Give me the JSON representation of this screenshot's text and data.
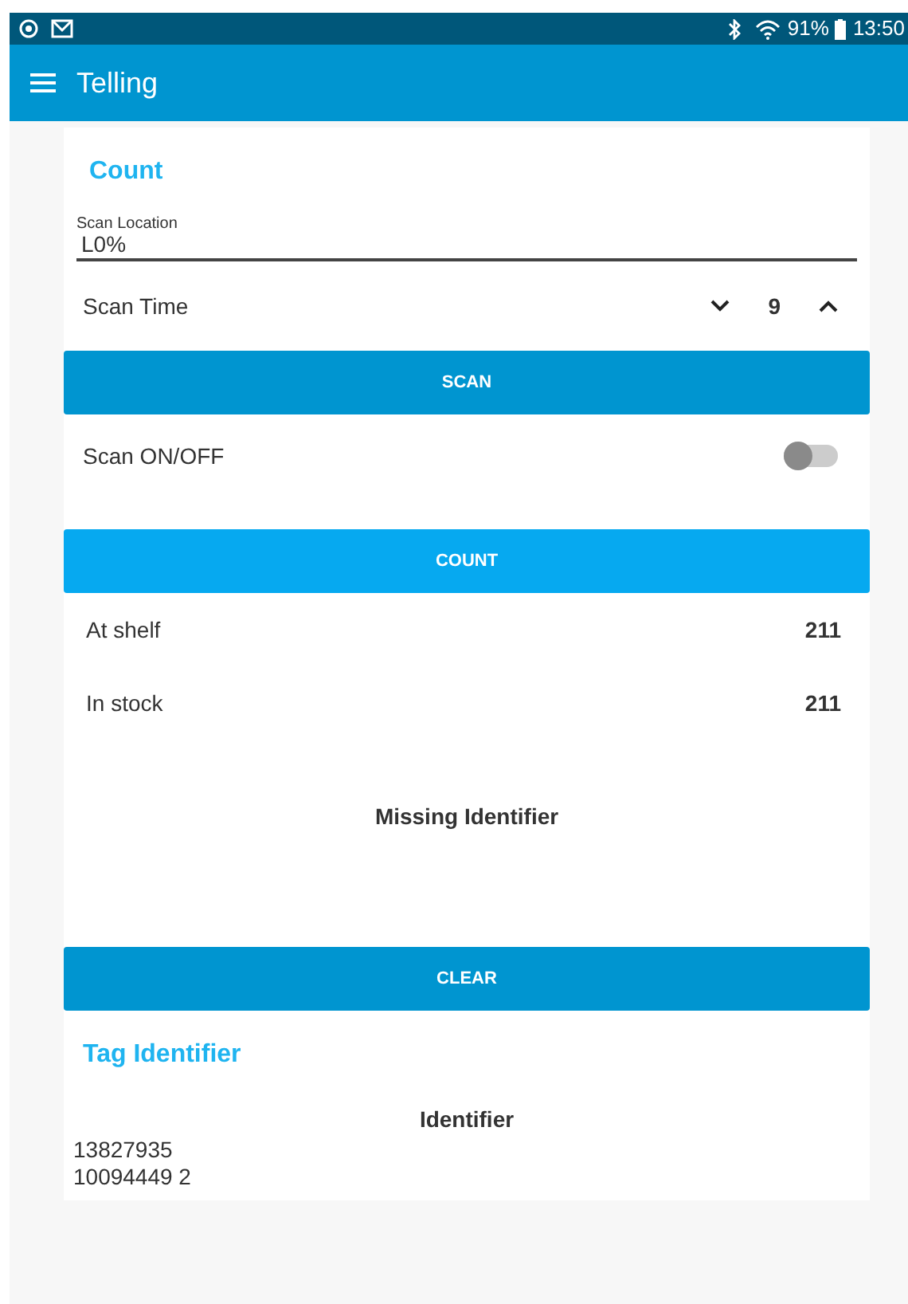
{
  "status_bar": {
    "battery": "91%",
    "time": "13:50"
  },
  "app_bar": {
    "title": "Telling"
  },
  "count_section": {
    "title": "Count",
    "scan_location": {
      "label": "Scan Location",
      "value": "L0%"
    },
    "scan_time": {
      "label": "Scan Time",
      "value": "9"
    },
    "scan_button": "SCAN",
    "scan_toggle": {
      "label": "Scan ON/OFF",
      "on": false
    },
    "count_button": "COUNT"
  },
  "counts": [
    {
      "label": "At shelf",
      "value": "211"
    },
    {
      "label": "In stock",
      "value": "211"
    }
  ],
  "missing_identifier": "Missing Identifier",
  "clear_button": "CLEAR",
  "tag_section": {
    "title": "Tag Identifier",
    "column": "Identifier",
    "rows": [
      "13827935",
      "10094449 2"
    ]
  }
}
